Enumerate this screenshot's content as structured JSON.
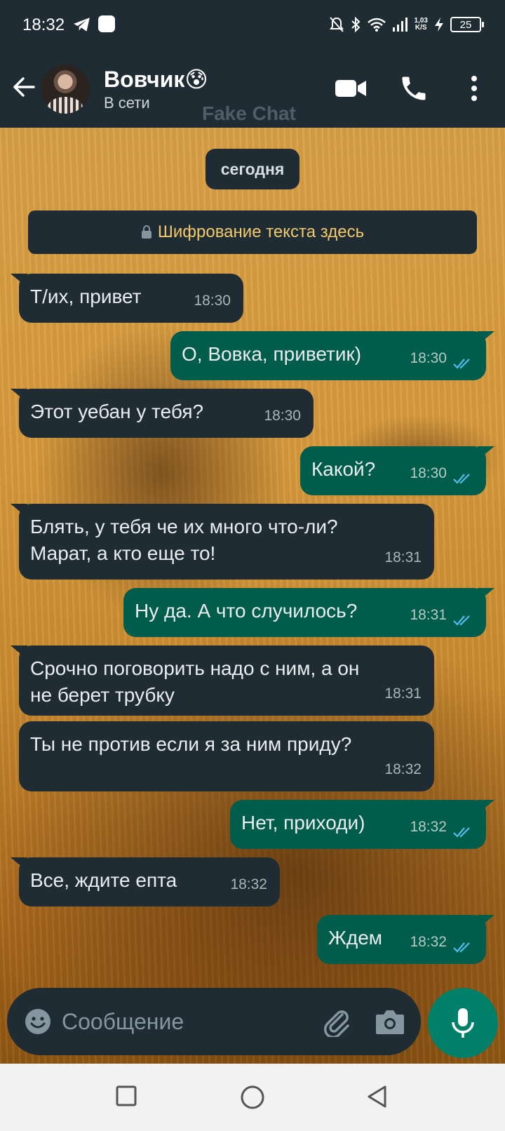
{
  "status_bar": {
    "time": "18:32",
    "net_speed_value": "1,03",
    "net_speed_unit": "K/S",
    "battery": "25",
    "icons": [
      "telegram-icon",
      "app-notification-icon",
      "mute-icon",
      "bluetooth-icon",
      "wifi-icon",
      "signal-icon",
      "charging-icon",
      "battery-icon"
    ]
  },
  "header": {
    "contact_name": "Вовчик😰",
    "contact_status": "В сети",
    "watermark": "Fake Chat",
    "icons": [
      "back-arrow-icon",
      "video-call-icon",
      "phone-icon",
      "more-vert-icon"
    ]
  },
  "chat": {
    "date_label": "сегодня",
    "encryption_notice": "Шифрование текста здесь",
    "messages": [
      {
        "direction": "in",
        "text": "Т/их, привет",
        "time": "18:30"
      },
      {
        "direction": "out",
        "text": "О, Вовка, приветик)",
        "time": "18:30",
        "status": "read"
      },
      {
        "direction": "in",
        "text": "Этот уебан у тебя?",
        "time": "18:30"
      },
      {
        "direction": "out",
        "text": "Какой?",
        "time": "18:30",
        "status": "read"
      },
      {
        "direction": "in",
        "text": "Блять, у тебя че их много что-ли?\nМарат, а кто еще то!",
        "time": "18:31"
      },
      {
        "direction": "out",
        "text": "Ну да. А что случилось?",
        "time": "18:31",
        "status": "read"
      },
      {
        "direction": "in",
        "text": "Срочно поговорить надо с ним, а он\nне берет трубку",
        "time": "18:31"
      },
      {
        "direction": "in",
        "text": "Ты не против если я за ним приду?",
        "time": "18:32"
      },
      {
        "direction": "out",
        "text": "Нет, приходи)",
        "time": "18:32",
        "status": "read"
      },
      {
        "direction": "in",
        "text": "Все, ждите епта",
        "time": "18:32"
      },
      {
        "direction": "out",
        "text": "Ждем",
        "time": "18:32",
        "status": "read"
      }
    ]
  },
  "composer": {
    "placeholder": "Сообщение",
    "value": ""
  },
  "colors": {
    "header_bg": "#1f2c34",
    "incoming_bubble": "#1f2c34",
    "outgoing_bubble": "#005c4b",
    "read_ticks": "#53bdeb",
    "mic_button": "#008069",
    "encryption_text": "#f2c96b"
  }
}
